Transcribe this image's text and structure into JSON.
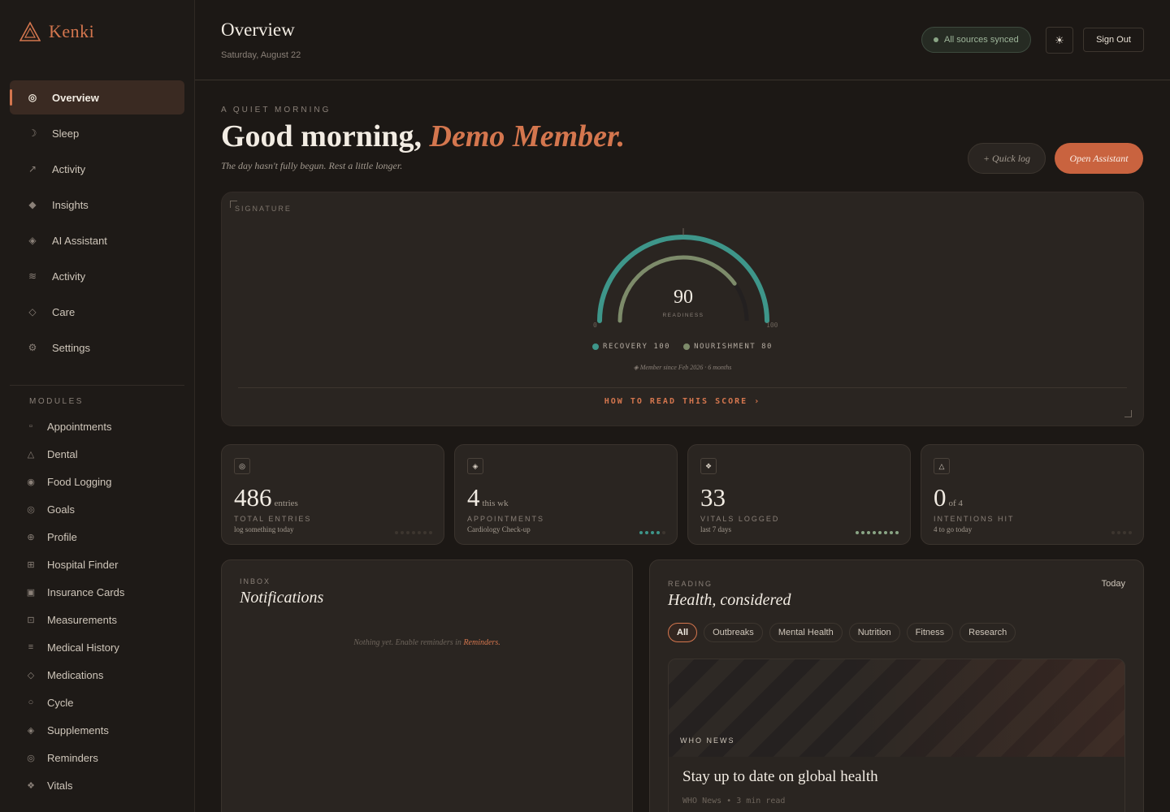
{
  "brand": {
    "name": "Kenki"
  },
  "nav": [
    {
      "label": "Overview",
      "icon": "◎",
      "icon_name": "target-icon",
      "active": true
    },
    {
      "label": "Sleep",
      "icon": "☽",
      "icon_name": "moon-icon"
    },
    {
      "label": "Activity",
      "icon": "↗",
      "icon_name": "trend-arrow-icon"
    },
    {
      "label": "Insights",
      "icon": "◆",
      "icon_name": "diamond-icon"
    },
    {
      "label": "AI Assistant",
      "icon": "◈",
      "icon_name": "diamond-dot-icon"
    },
    {
      "label": "Activity",
      "icon": "≋",
      "icon_name": "waves-icon"
    },
    {
      "label": "Care",
      "icon": "◇",
      "icon_name": "diamond-outline-icon"
    },
    {
      "label": "Settings",
      "icon": "⚙",
      "icon_name": "gear-icon"
    }
  ],
  "modules_label": "MODULES",
  "modules": [
    {
      "label": "Appointments",
      "icon": "▫",
      "icon_name": "square-icon"
    },
    {
      "label": "Dental",
      "icon": "△",
      "icon_name": "triangle-icon"
    },
    {
      "label": "Food Logging",
      "icon": "◉",
      "icon_name": "dot-circle-icon"
    },
    {
      "label": "Goals",
      "icon": "◎",
      "icon_name": "target-icon"
    },
    {
      "label": "Profile",
      "icon": "⊕",
      "icon_name": "circle-plus-icon"
    },
    {
      "label": "Hospital Finder",
      "icon": "⊞",
      "icon_name": "grid-icon"
    },
    {
      "label": "Insurance Cards",
      "icon": "▣",
      "icon_name": "card-icon"
    },
    {
      "label": "Measurements",
      "icon": "⊡",
      "icon_name": "square-dot-icon"
    },
    {
      "label": "Medical History",
      "icon": "≡",
      "icon_name": "list-icon"
    },
    {
      "label": "Medications",
      "icon": "◇",
      "icon_name": "diamond-outline-icon"
    },
    {
      "label": "Cycle",
      "icon": "○",
      "icon_name": "circle-icon"
    },
    {
      "label": "Supplements",
      "icon": "◈",
      "icon_name": "diamond-dot-icon"
    },
    {
      "label": "Reminders",
      "icon": "◎",
      "icon_name": "target-icon"
    },
    {
      "label": "Vitals",
      "icon": "❖",
      "icon_name": "sparkle-icon"
    }
  ],
  "header": {
    "title": "Overview",
    "date": "Saturday, August 22",
    "synced": "All sources synced",
    "theme_icon": "☀",
    "sign_out": "Sign Out"
  },
  "hero": {
    "eyebrow": "A QUIET MORNING",
    "greeting": "Good morning,",
    "name": "Demo Member.",
    "sub": "The day hasn't fully begun. Rest a little longer.",
    "quick_log": "+ Quick log",
    "open_assistant": "Open Assistant"
  },
  "signature": {
    "label": "SIGNATURE",
    "score": "90",
    "score_label": "READINESS",
    "min_label": "0",
    "max_label": "100",
    "recovery": {
      "label": "RECOVERY 100",
      "value": 100,
      "color": "#3e968a"
    },
    "nourishment": {
      "label": "NOURISHMENT 80",
      "value": 80,
      "color": "#7d8b6a"
    },
    "member_since": "◈ Member since Feb 2026 · 6 months",
    "how_to": "HOW TO READ THIS SCORE ›"
  },
  "stats": [
    {
      "icon": "◎",
      "icon_name": "target-icon",
      "value": "486",
      "unit": "entries",
      "label": "TOTAL ENTRIES",
      "note": "log something today",
      "dots_total": 7,
      "dots_on": 0,
      "dot_color": "#3d362f"
    },
    {
      "icon": "◈",
      "icon_name": "calendar-icon",
      "value": "4",
      "unit": "this wk",
      "label": "APPOINTMENTS",
      "note": "Cardiology Check-up",
      "dots_total": 5,
      "dots_on": 4,
      "dot_color": "#3e968a"
    },
    {
      "icon": "❖",
      "icon_name": "vitals-icon",
      "value": "33",
      "unit": "",
      "label": "VITALS LOGGED",
      "note": "last 7 days",
      "dots_total": 8,
      "dots_on": 8,
      "dot_color": "#8aa585"
    },
    {
      "icon": "△",
      "icon_name": "triangle-icon",
      "value": "0",
      "unit": "of 4",
      "label": "INTENTIONS HIT",
      "note": "4 to go today",
      "dots_total": 4,
      "dots_on": 0,
      "dot_color": "#3d362f"
    }
  ],
  "notifications": {
    "eyebrow": "INBOX",
    "title": "Notifications",
    "empty_text": "Nothing yet. Enable reminders in",
    "empty_link": "Reminders."
  },
  "reading": {
    "eyebrow": "READING",
    "title": "Health, considered",
    "today": "Today",
    "chips": [
      "All",
      "Outbreaks",
      "Mental Health",
      "Nutrition",
      "Fitness",
      "Research"
    ],
    "active_chip": 0,
    "article": {
      "source": "WHO NEWS",
      "title": "Stay up to date on global health",
      "meta": "WHO News  •  3 min read"
    }
  },
  "colors": {
    "accent": "#d4764e",
    "teal": "#3e968a",
    "sage": "#7d8b6a",
    "bg": "#1c1815",
    "card": "#2a2521"
  }
}
